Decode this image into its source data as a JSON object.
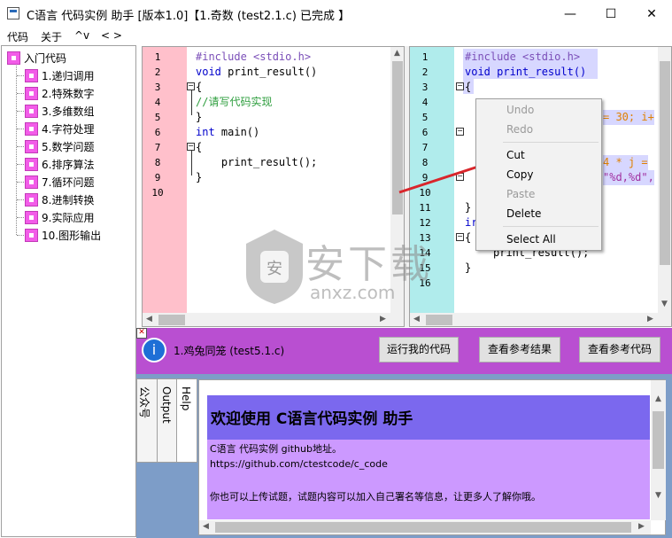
{
  "window": {
    "title": "C语言 代码实例 助手 [版本1.0]【1.奇数 (test2.1.c) 已完成 】",
    "minimize": "—",
    "maximize": "☐",
    "close": "✕"
  },
  "menu": [
    "代码",
    "关于",
    "^v",
    "< >"
  ],
  "tree": {
    "root": "入门代码",
    "items": [
      "1.递归调用",
      "2.特殊数字",
      "3.多维数组",
      "4.字符处理",
      "5.数学问题",
      "6.排序算法",
      "7.循环问题",
      "8.进制转换",
      "9.实际应用",
      "10.图形输出"
    ]
  },
  "left_editor": {
    "line_numbers": [
      "1",
      "2",
      "3",
      "4",
      "5",
      "6",
      "7",
      "8",
      "9",
      "10"
    ],
    "lines": [
      {
        "parts": [
          {
            "c": "pp",
            "t": "#include <stdio.h>"
          }
        ]
      },
      {
        "parts": [
          {
            "c": "kw",
            "t": "void"
          },
          {
            "c": "",
            "t": " print_result()"
          }
        ]
      },
      {
        "parts": [
          {
            "c": "",
            "t": "{"
          }
        ]
      },
      {
        "parts": [
          {
            "c": "cm",
            "t": "//请写代码实现"
          }
        ]
      },
      {
        "parts": [
          {
            "c": "",
            "t": "}"
          }
        ]
      },
      {
        "parts": [
          {
            "c": "kw",
            "t": "int"
          },
          {
            "c": "",
            "t": " main()"
          }
        ]
      },
      {
        "parts": [
          {
            "c": "",
            "t": "{"
          }
        ]
      },
      {
        "parts": [
          {
            "c": "",
            "t": "    print_result();"
          }
        ]
      },
      {
        "parts": [
          {
            "c": "",
            "t": "}"
          }
        ]
      },
      {
        "parts": [
          {
            "c": "",
            "t": ""
          }
        ]
      }
    ]
  },
  "right_editor": {
    "line_numbers": [
      "1",
      "2",
      "3",
      "4",
      "5",
      "6",
      "7",
      "8",
      "9",
      "10",
      "11",
      "12",
      "13",
      "14",
      "15",
      "16"
    ],
    "visible_fragments": {
      "l1": "#include <stdio.h>",
      "l2": "void print_result()",
      "l3": "{",
      "l5": "= 30; i+",
      "l8": "4 * j =",
      "l9": "\"%d,%d\",",
      "l11": "}",
      "l12": "ir",
      "l13": "{",
      "l14": "print_result();",
      "l15": "}"
    }
  },
  "context_menu": {
    "undo": "Undo",
    "redo": "Redo",
    "cut": "Cut",
    "copy": "Copy",
    "paste": "Paste",
    "delete": "Delete",
    "select_all": "Select All"
  },
  "action_bar": {
    "info_icon": "i",
    "current": "1.鸡兔同笼 (test5.1.c)",
    "run_btn": "运行我的代码",
    "ref_result_btn": "查看参考结果",
    "ref_code_btn": "查看参考代码"
  },
  "bottom_tabs": [
    "公众号",
    "Output",
    "Help"
  ],
  "help": {
    "heading": "欢迎使用 C语言代码实例 助手",
    "line1": "C语言 代码实例 github地址。",
    "line2": "https://github.com/ctestcode/c_code",
    "line3": "你也可以上传试题，试题内容可以加入自己署名等信息，让更多人了解你哦。"
  },
  "watermark": {
    "text": "安下载",
    "sub": "anxz.com"
  },
  "colors": {
    "gutter_left": "#ffc0cb",
    "gutter_right": "#b0ecec",
    "action_bar": "#b94fd1",
    "help_header": "#7b68ee",
    "help_body": "#cc99ff",
    "tree_icon": "#f25ce8"
  }
}
